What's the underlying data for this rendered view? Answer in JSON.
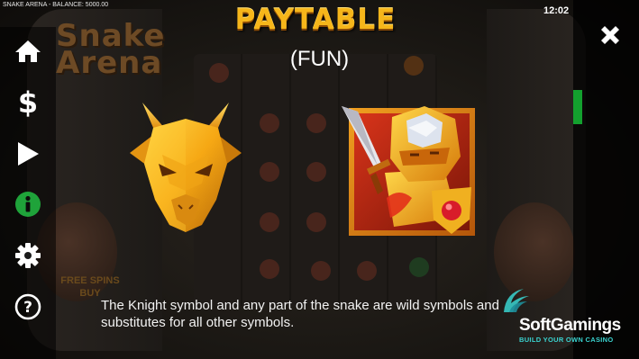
{
  "status_bar": {
    "title": "SNAKE ARENA - BALANCE: 5000.00",
    "clock": "12:02"
  },
  "sidebar": {
    "items": [
      {
        "name": "home",
        "icon": "home-icon"
      },
      {
        "name": "bet",
        "icon": "dollar-icon"
      },
      {
        "name": "autoplay",
        "icon": "play-icon"
      },
      {
        "name": "info",
        "icon": "info-icon",
        "active": true
      },
      {
        "name": "settings",
        "icon": "gear-icon"
      },
      {
        "name": "help",
        "icon": "question-icon"
      }
    ],
    "icon_color": "#ffffff",
    "active_color": "#1fa33a"
  },
  "background": {
    "logo_text": "Snake Arena",
    "free_spins_text": "FREE SPINS BUY"
  },
  "paytable": {
    "title": "PAYTABLE",
    "subtitle": "(FUN)",
    "title_color": "#f6b61a",
    "symbols": [
      "dragon",
      "knight"
    ],
    "description": "The Knight symbol and any part of the snake are wild symbols and substitutes for all other symbols."
  },
  "right_panel": {
    "close_icon": "close-icon",
    "scroll_color": "#13a02e"
  },
  "brand": {
    "name": "SoftGamings",
    "tagline": "BUILD YOUR OWN CASINO",
    "tagline_color": "#3ad3d0"
  }
}
